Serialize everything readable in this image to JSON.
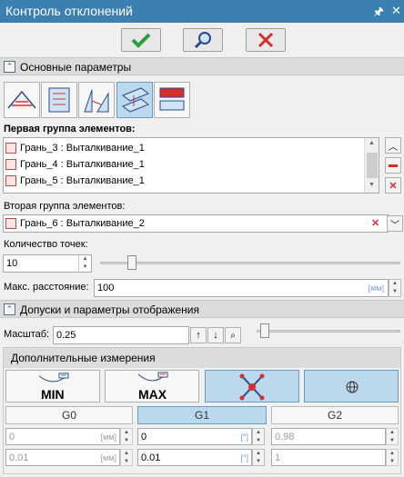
{
  "window": {
    "title": "Контроль отклонений"
  },
  "main_params": {
    "title": "Основные параметры"
  },
  "group1": {
    "label": "Первая группа элементов:",
    "items": [
      "Грань_3 : Выталкивание_1",
      "Грань_4 : Выталкивание_1",
      "Грань_5 : Выталкивание_1"
    ]
  },
  "group2": {
    "label": "Вторая группа элементов:",
    "value": "Грань_6 : Выталкивание_2"
  },
  "points": {
    "label": "Количество точек:",
    "value": "10",
    "slider_fraction": 0.09
  },
  "maxdist": {
    "label": "Макс. расстояние:",
    "value": "100",
    "unit": "[мм]"
  },
  "tolerances": {
    "title": "Допуски и параметры отображения"
  },
  "scale": {
    "label": "Масштаб:",
    "value": "0.25",
    "slider_fraction": 0.02
  },
  "extra": {
    "title": "Дополнительные измерения",
    "min_label": "MIN",
    "max_label": "MAX"
  },
  "g": {
    "g0": "G0",
    "g1": "G1",
    "g2": "G2"
  },
  "rows": [
    {
      "a": "0",
      "a_unit": "[мм]",
      "b": "0",
      "b_unit": "[°]",
      "c": "0.98"
    },
    {
      "a": "0.01",
      "a_unit": "[мм]",
      "b": "0.01",
      "b_unit": "[°]",
      "c": "1"
    }
  ],
  "colors": {
    "title_bg": "#3c7fb1",
    "selected": "#bcd8ec",
    "accent_red": "#d32f2f",
    "accent_green": "#2e9e3a"
  }
}
